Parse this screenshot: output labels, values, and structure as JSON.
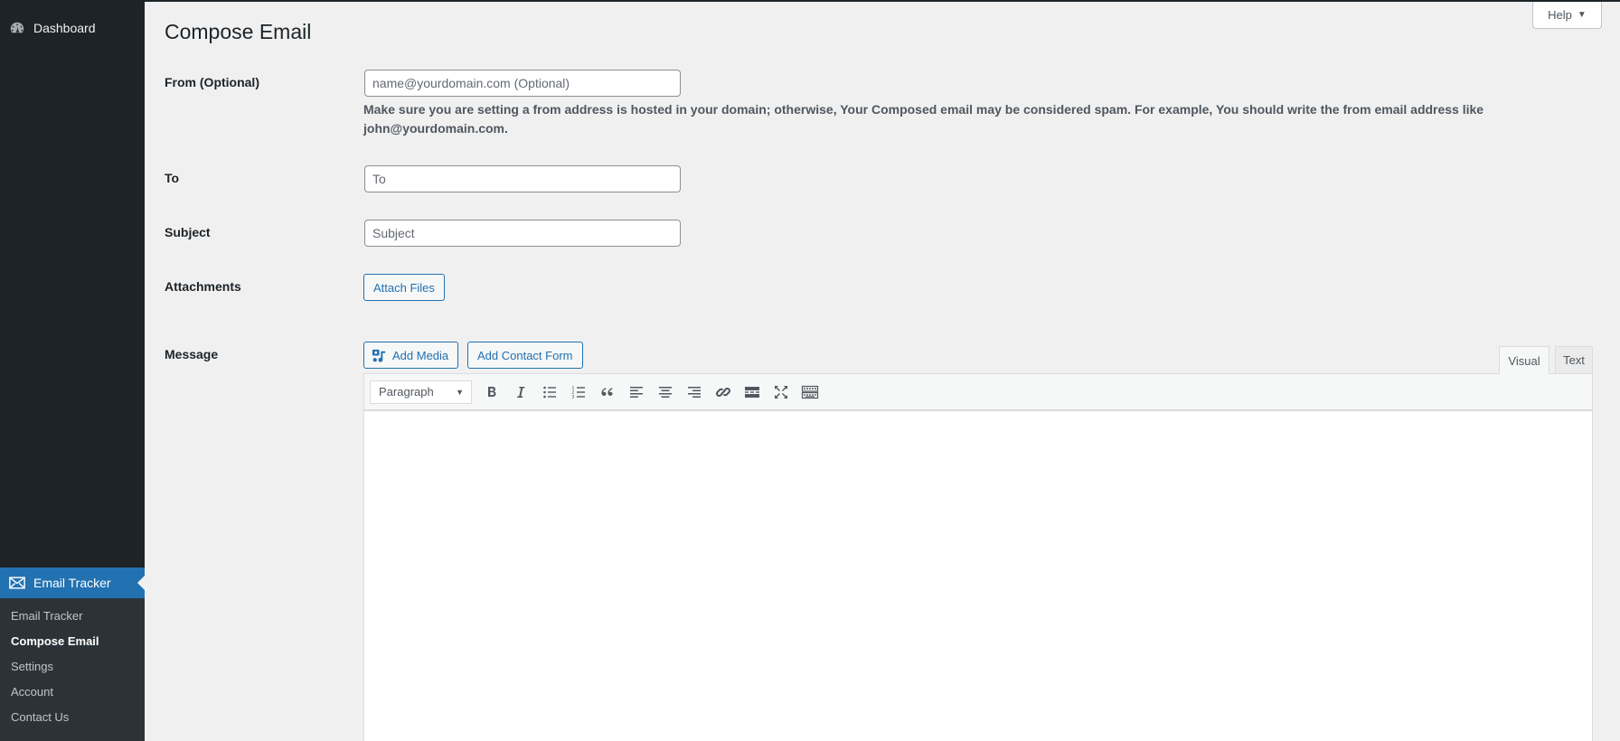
{
  "sidebar": {
    "dashboard": {
      "label": "Dashboard",
      "icon": "dashboard-icon"
    },
    "active_menu": {
      "label": "Email Tracker",
      "icon": "email-icon"
    },
    "submenu": [
      {
        "label": "Email Tracker",
        "current": false
      },
      {
        "label": "Compose Email",
        "current": true
      },
      {
        "label": "Settings",
        "current": false
      },
      {
        "label": "Account",
        "current": false
      },
      {
        "label": "Contact Us",
        "current": false
      }
    ]
  },
  "help": {
    "label": "Help",
    "icon": "triangle-down-icon"
  },
  "page": {
    "title": "Compose Email"
  },
  "form": {
    "from": {
      "label": "From (Optional)",
      "placeholder": "name@yourdomain.com (Optional)",
      "value": "",
      "description": "Make sure you are setting a from address is hosted in your domain; otherwise, Your Composed email may be considered spam. For example, You should write the from email address like john@yourdomain.com."
    },
    "to": {
      "label": "To",
      "placeholder": "To",
      "value": ""
    },
    "subject": {
      "label": "Subject",
      "placeholder": "Subject",
      "value": ""
    },
    "attachments": {
      "label": "Attachments",
      "button": "Attach Files"
    },
    "message": {
      "label": "Message",
      "add_media": "Add Media",
      "add_contact_form": "Add Contact Form",
      "tabs": {
        "visual": "Visual",
        "text": "Text",
        "active": "Visual"
      },
      "format": "Paragraph",
      "toolbar": [
        "bold",
        "italic",
        "bulleted-list",
        "numbered-list",
        "blockquote",
        "align-left",
        "align-center",
        "align-right",
        "insert-link",
        "read-more",
        "fullscreen",
        "toolbar-toggle"
      ],
      "content": ""
    }
  }
}
